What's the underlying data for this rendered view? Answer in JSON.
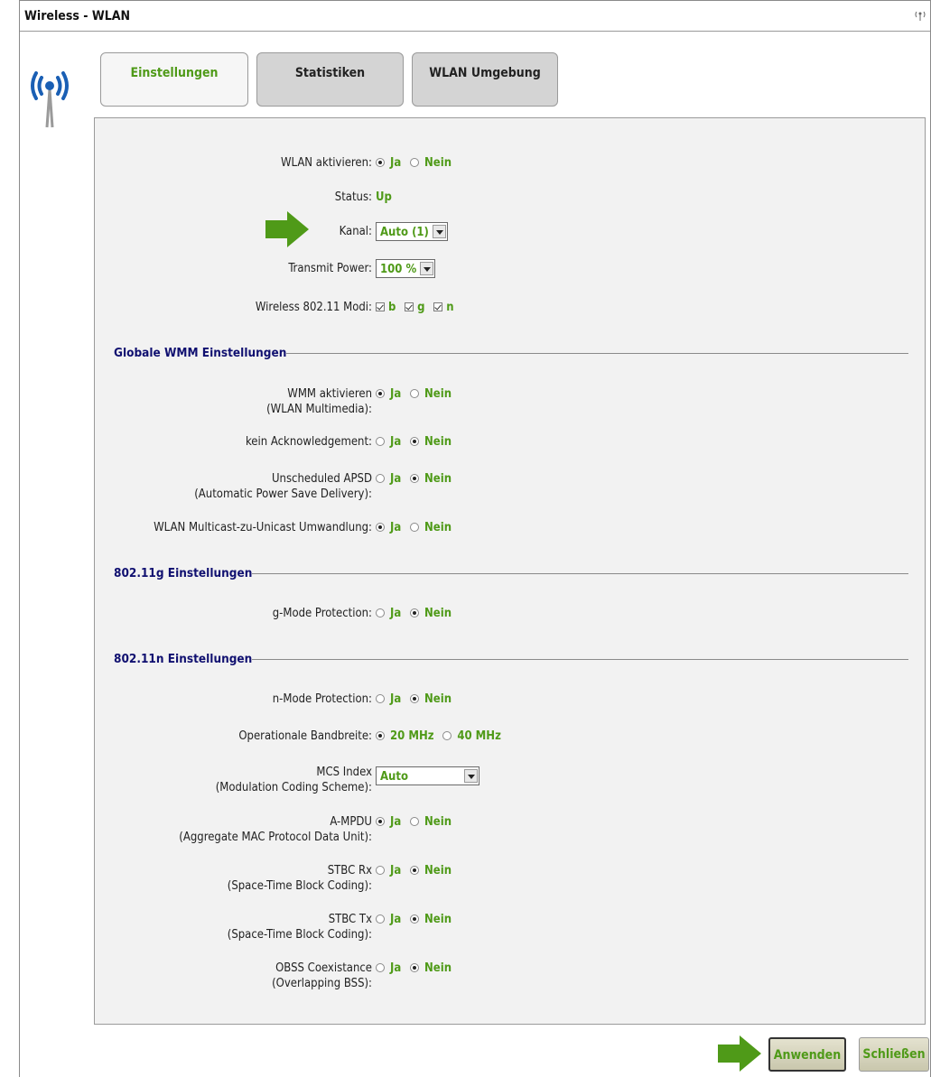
{
  "window": {
    "title": "Wireless - WLAN"
  },
  "icons": {
    "main": "wlan-antenna-icon",
    "title_small": "wlan-small-icon",
    "pointer": "green-arrow-icon"
  },
  "colors": {
    "accent_green": "#4f9a18",
    "section_blue": "#101070",
    "panel_bg": "#f2f2f2"
  },
  "tabs": [
    {
      "label": "Einstellungen",
      "active": true
    },
    {
      "label": "Statistiken",
      "active": false
    },
    {
      "label": "WLAN Umgebung",
      "active": false
    }
  ],
  "options": {
    "yes": "Ja",
    "no": "Nein"
  },
  "general": {
    "wlan_activate": {
      "label": "WLAN aktivieren:",
      "value": "Ja"
    },
    "status": {
      "label": "Status:",
      "value": "Up"
    },
    "channel": {
      "label": "Kanal:",
      "value": "Auto (1)"
    },
    "transmit_power": {
      "label": "Transmit Power:",
      "value": "100 %"
    },
    "modes": {
      "label": "Wireless 802.11 Modi:",
      "items": [
        "b",
        "g",
        "n"
      ]
    }
  },
  "wmm": {
    "heading": "Globale WMM Einstellungen",
    "wmm_activate": {
      "label1": "WMM aktivieren",
      "label2": "(WLAN Multimedia):",
      "value": "Ja"
    },
    "no_ack": {
      "label": "kein Acknowledgement:",
      "value": "Nein"
    },
    "apsd": {
      "label1": "Unscheduled APSD",
      "label2": "(Automatic Power Save Delivery):",
      "value": "Nein"
    },
    "multicast": {
      "label": "WLAN Multicast-zu-Unicast Umwandlung:",
      "value": "Ja"
    }
  },
  "g_settings": {
    "heading": "802.11g Einstellungen",
    "g_protection": {
      "label": "g-Mode Protection:",
      "value": "Nein"
    }
  },
  "n_settings": {
    "heading": "802.11n Einstellungen",
    "n_protection": {
      "label": "n-Mode Protection:",
      "value": "Nein"
    },
    "bandwidth": {
      "label": "Operationale Bandbreite:",
      "opt1": "20 MHz",
      "opt2": "40 MHz",
      "value": "20 MHz"
    },
    "mcs": {
      "label1": "MCS Index",
      "label2": "(Modulation Coding Scheme):",
      "value": "Auto"
    },
    "ampdu": {
      "label1": "A-MPDU",
      "label2": "(Aggregate MAC Protocol Data Unit):",
      "value": "Ja"
    },
    "stbc_rx": {
      "label1": "STBC Rx",
      "label2": "(Space-Time Block Coding):",
      "value": "Nein"
    },
    "stbc_tx": {
      "label1": "STBC Tx",
      "label2": "(Space-Time Block Coding):",
      "value": "Nein"
    },
    "obss": {
      "label1": "OBSS Coexistance",
      "label2": "(Overlapping BSS):",
      "value": "Nein"
    }
  },
  "buttons": {
    "apply": "Anwenden",
    "close": "Schließen"
  }
}
